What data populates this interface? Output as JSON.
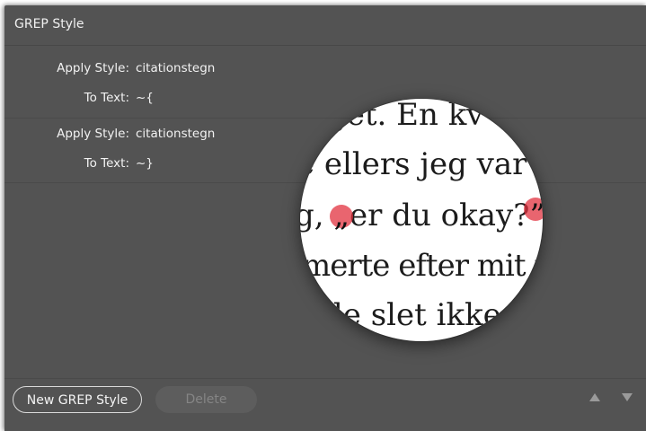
{
  "panel": {
    "title": "GREP Style"
  },
  "rules": [
    {
      "apply_label": "Apply Style:",
      "apply_value": "citationstegn",
      "text_label": "To Text:",
      "text_value": "~{"
    },
    {
      "apply_label": "Apply Style:",
      "apply_value": "citationstegn",
      "text_label": "To Text:",
      "text_value": "~}"
    }
  ],
  "footer": {
    "new_button_label": "New GREP Style",
    "delete_button_label": "Delete"
  },
  "magnifier": {
    "lines": [
      "get. En kv",
      "e ellers jeg var",
      "g, „er du okay?\", ",
      "merte efter mit f",
      "de slet ikke"
    ],
    "line3_pre": "g, ",
    "line3_open_quote": "„",
    "line3_mid": "er du okay?",
    "line3_close_quote": "”",
    "line3_post": ", "
  },
  "colors": {
    "panel_bg": "#535353",
    "highlight": "#e2323f"
  }
}
